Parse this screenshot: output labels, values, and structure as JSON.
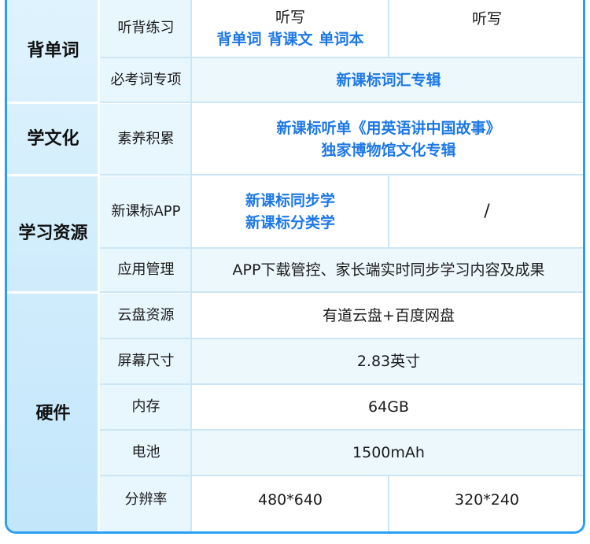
{
  "categories": {
    "words": "背单词",
    "culture": "学文化",
    "resources": "学习资源",
    "hardware": "硬件"
  },
  "rows": {
    "listen_practice": {
      "label": "听背练习",
      "left_top": "听写",
      "left_items": [
        "背单词",
        "背课文",
        "单词本"
      ],
      "right": "听写"
    },
    "exam_words": {
      "label": "必考词专项",
      "value": "新课标词汇专辑"
    },
    "literacy": {
      "label": "素养积累",
      "line1": "新课标听单《用英语讲中国故事》",
      "line2": "独家博物馆文化专辑"
    },
    "app": {
      "label": "新课标APP",
      "left_line1": "新课标同步学",
      "left_line2": "新课标分类学",
      "right": "/"
    },
    "app_manage": {
      "label": "应用管理",
      "value": "APP下载管控、家长端实时同步学习内容及成果"
    },
    "cloud": {
      "label": "云盘资源",
      "value": "有道云盘+百度网盘"
    },
    "screen": {
      "label": "屏幕尺寸",
      "value": "2.83英寸"
    },
    "memory": {
      "label": "内存",
      "value": "64GB"
    },
    "battery": {
      "label": "电池",
      "value": "1500mAh"
    },
    "resolution": {
      "label": "分辨率",
      "left": "480*640",
      "right": "320*240"
    }
  },
  "colors": {
    "accent": "#1d78e6",
    "border": "#2a9ff2",
    "category_bg": "#c3e6fb"
  }
}
